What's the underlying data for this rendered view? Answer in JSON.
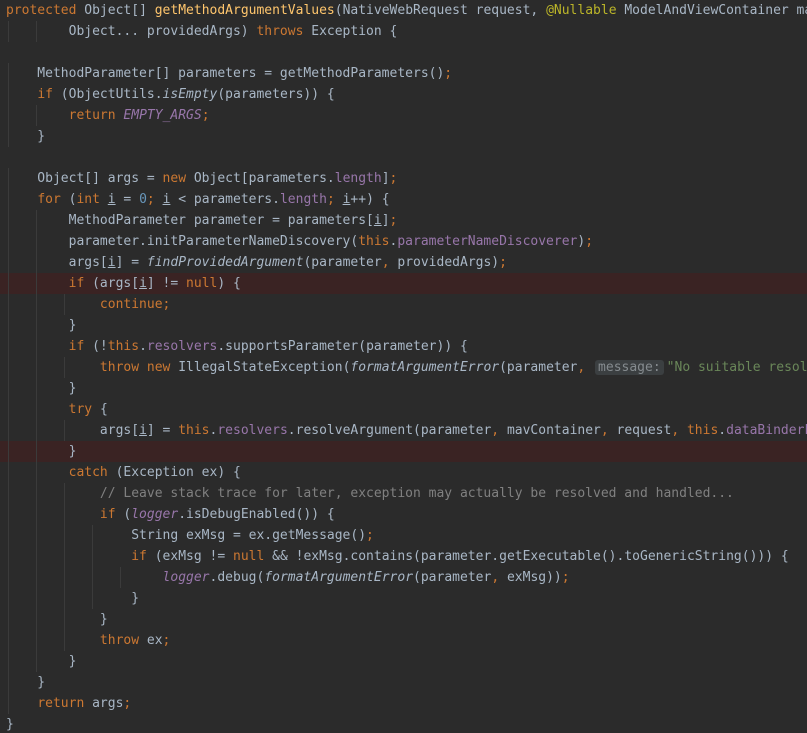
{
  "editor": {
    "colors": {
      "background": "#2b2b2b",
      "highlighted_line": "#3a2323",
      "default_text": "#a9b7c6",
      "keyword": "#cc7832",
      "method_declaration": "#ffc66d",
      "annotation": "#bbb529",
      "number": "#6897bb",
      "string": "#6a8759",
      "comment": "#808080",
      "field": "#9876aa",
      "hint_background": "#3b3f41",
      "hint_text": "#858b8f"
    },
    "highlighted_lines": [
      13,
      21
    ],
    "lines": [
      [
        [
          "kw",
          "protected "
        ],
        [
          "",
          "Object[] "
        ],
        [
          "fn",
          "getMethodArgumentValues"
        ],
        [
          "",
          "(NativeWebRequest request, "
        ],
        [
          "ann",
          "@Nullable "
        ],
        [
          "",
          "ModelAndViewContainer mavContainer"
        ],
        [
          "kw",
          ","
        ]
      ],
      [
        [
          "",
          "        Object... providedArgs) "
        ],
        [
          "kw",
          "throws "
        ],
        [
          "",
          "Exception {"
        ]
      ],
      [],
      [
        [
          "",
          "    MethodParameter[] parameters = getMethodParameters()"
        ],
        [
          "kw",
          ";"
        ]
      ],
      [
        [
          "",
          "    "
        ],
        [
          "kw",
          "if "
        ],
        [
          "",
          "(ObjectUtils."
        ],
        [
          "smeth",
          "isEmpty"
        ],
        [
          "",
          "(parameters)) {"
        ]
      ],
      [
        [
          "",
          "        "
        ],
        [
          "kw",
          "return "
        ],
        [
          "sfld",
          "EMPTY_ARGS"
        ],
        [
          "kw",
          ";"
        ]
      ],
      [
        [
          "",
          "    }"
        ]
      ],
      [],
      [
        [
          "",
          "    Object[] args = "
        ],
        [
          "kw",
          "new "
        ],
        [
          "",
          "Object[parameters."
        ],
        [
          "fld",
          "length"
        ],
        [
          "",
          "]"
        ],
        [
          "kw",
          ";"
        ]
      ],
      [
        [
          "",
          "    "
        ],
        [
          "kw",
          "for "
        ],
        [
          "",
          "("
        ],
        [
          "kw",
          "int "
        ],
        [
          "ul",
          "i"
        ],
        [
          "",
          ", "
        ],
        [
          "",
          ""
        ],
        [
          "",
          "= "
        ],
        [
          "num",
          "0"
        ],
        [
          "kw",
          "; "
        ],
        [
          "ul",
          "i"
        ],
        [
          "",
          ""
        ],
        [
          "",
          ""
        ],
        [
          "",
          ""
        ],
        [
          "",
          ""
        ],
        [
          "",
          ""
        ],
        [
          "",
          ""
        ],
        [
          "",
          ""
        ],
        [
          "",
          ""
        ]
      ],
      [
        [
          "",
          "        MethodParameter parameter = parameters["
        ],
        [
          "ul",
          "i"
        ],
        [
          "",
          "]"
        ],
        [
          "kw",
          ";"
        ]
      ],
      [
        [
          "",
          "        parameter.initParameterNameDiscovery("
        ],
        [
          "kw",
          "this"
        ],
        [
          "",
          "."
        ],
        [
          "fld",
          "parameterNameDiscoverer"
        ],
        [
          "",
          ")"
        ],
        [
          "kw",
          ";"
        ]
      ],
      [
        [
          "",
          "        args["
        ],
        [
          "ul",
          "i"
        ],
        [
          "",
          "] = "
        ],
        [
          "smeth",
          "findProvidedArgument"
        ],
        [
          "",
          "(parameter"
        ],
        [
          "kw",
          ", "
        ],
        [
          "",
          "providedArgs)"
        ],
        [
          "kw",
          ";"
        ]
      ],
      [
        [
          "",
          "        "
        ],
        [
          "kw",
          "if "
        ],
        [
          "",
          "(args["
        ],
        [
          "ul",
          "i"
        ],
        [
          "",
          "] != "
        ],
        [
          "kw",
          "null"
        ],
        [
          "",
          ") {"
        ]
      ],
      [
        [
          "",
          "            "
        ],
        [
          "kw",
          "continue;"
        ]
      ],
      [
        [
          "",
          "        }"
        ]
      ],
      [
        [
          "",
          "        "
        ],
        [
          "kw",
          "if "
        ],
        [
          "",
          "(!"
        ],
        [
          "kw",
          "this"
        ],
        [
          "",
          "."
        ],
        [
          "fld",
          "resolvers"
        ],
        [
          "",
          ".supportsParameter(parameter)) {"
        ]
      ],
      [
        [
          "",
          "            "
        ],
        [
          "kw",
          "throw new "
        ],
        [
          "",
          "IllegalStateException("
        ],
        [
          "smeth",
          "formatArgumentError"
        ],
        [
          "",
          "(parameter"
        ],
        [
          "kw",
          ", "
        ],
        [
          "hint",
          "message:"
        ],
        [
          "str",
          "\"No suitable resolver\""
        ],
        [
          "",
          "))"
        ],
        [
          "kw",
          ";"
        ]
      ],
      [
        [
          "",
          "        }"
        ]
      ],
      [
        [
          "",
          "        "
        ],
        [
          "kw",
          "try "
        ],
        [
          "",
          "{"
        ]
      ],
      [
        [
          "",
          "            args["
        ],
        [
          "ul",
          "i"
        ],
        [
          "",
          "] = "
        ],
        [
          "kw",
          "this"
        ],
        [
          "",
          "."
        ],
        [
          "fld",
          "resolvers"
        ],
        [
          "",
          ".resolveArgument(parameter"
        ],
        [
          "kw",
          ", "
        ],
        [
          "",
          "mavContainer"
        ],
        [
          "kw",
          ", "
        ],
        [
          "",
          "request"
        ],
        [
          "kw",
          ", "
        ],
        [
          "kw",
          "this"
        ],
        [
          "",
          "."
        ],
        [
          "fld",
          "dataBinderFactory"
        ],
        [
          "",
          ")"
        ],
        [
          "kw",
          ";"
        ]
      ],
      [
        [
          "",
          "        }"
        ]
      ],
      [
        [
          "",
          "        "
        ],
        [
          "kw",
          "catch "
        ],
        [
          "",
          "(Exception ex) {"
        ]
      ],
      [
        [
          "",
          "            "
        ],
        [
          "cm",
          "// Leave stack trace for later, exception may actually be resolved and handled..."
        ]
      ],
      [
        [
          "",
          "            "
        ],
        [
          "kw",
          "if "
        ],
        [
          "",
          "("
        ],
        [
          "sfld",
          "logger"
        ],
        [
          "",
          ".isDebugEnabled()) {"
        ]
      ],
      [
        [
          "",
          "                String exMsg = ex.getMessage()"
        ],
        [
          "kw",
          ";"
        ]
      ],
      [
        [
          "",
          "                "
        ],
        [
          "kw",
          "if "
        ],
        [
          "",
          "(exMsg != "
        ],
        [
          "kw",
          "null "
        ],
        [
          "",
          "&& !exMsg.contains(parameter.getExecutable().toGenericString())) {"
        ]
      ],
      [
        [
          "",
          "                    "
        ],
        [
          "sfld",
          "logger"
        ],
        [
          "",
          ".debug("
        ],
        [
          "smeth",
          "formatArgumentError"
        ],
        [
          "",
          "(parameter"
        ],
        [
          "kw",
          ", "
        ],
        [
          "",
          "exMsg))"
        ],
        [
          "kw",
          ";"
        ]
      ],
      [
        [
          "",
          "                }"
        ]
      ],
      [
        [
          "",
          "            }"
        ]
      ],
      [
        [
          "",
          "            "
        ],
        [
          "kw",
          "throw "
        ],
        [
          "",
          "ex"
        ],
        [
          "kw",
          ";"
        ]
      ],
      [
        [
          "",
          "        }"
        ]
      ],
      [
        [
          "",
          "    }"
        ]
      ],
      [
        [
          "",
          "    "
        ],
        [
          "kw",
          "return "
        ],
        [
          "",
          "args"
        ],
        [
          "kw",
          ";"
        ]
      ],
      [
        [
          "",
          "}"
        ]
      ]
    ]
  }
}
